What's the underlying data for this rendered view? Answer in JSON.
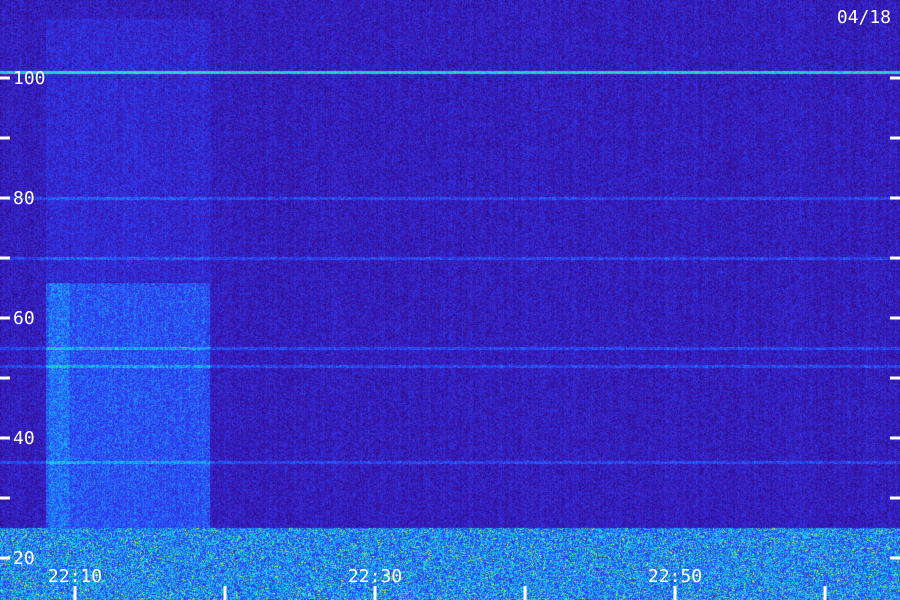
{
  "date_label": "04/18",
  "chart_data": {
    "type": "heatmap",
    "title": "",
    "xlabel": "",
    "ylabel": "",
    "x_tick_labels": [
      "22:10",
      "22:30",
      "22:50"
    ],
    "y_tick_labels": [
      "100",
      "80",
      "60",
      "40",
      "20"
    ],
    "ylim": [
      13,
      113
    ],
    "y_ticks_labeled": [
      100,
      80,
      60,
      40,
      20
    ],
    "y_ticks_minor": [
      90,
      70,
      50,
      30
    ],
    "xlim_minutes": [
      "22:05",
      "23:05"
    ],
    "x_ticks": [
      "22:10",
      "22:20",
      "22:30",
      "22:40",
      "22:50",
      "23:00"
    ],
    "colormap": [
      "#1a0650",
      "#3a14b0",
      "#2a48ff",
      "#18c8f0",
      "#30f0a0",
      "#f0f000"
    ],
    "features": {
      "narrowband_lines": [
        101,
        80,
        70,
        52,
        36,
        55
      ],
      "broadband_noise_band": [
        13,
        25
      ],
      "burst_column_minutes": [
        "22:08",
        "22:19"
      ]
    }
  }
}
